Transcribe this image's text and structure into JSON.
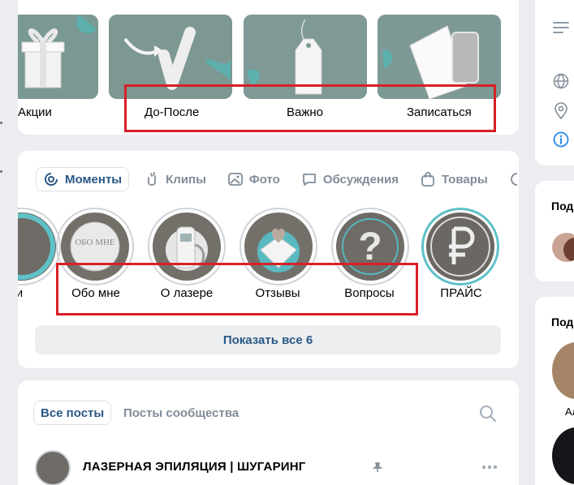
{
  "albums": {
    "items": [
      {
        "label": "Акции",
        "icon": "gift-icon"
      },
      {
        "label": "До-После",
        "icon": "checkmark-arrow-icon"
      },
      {
        "label": "Важно",
        "icon": "price-tag-icon"
      },
      {
        "label": "Записаться",
        "icon": "notepad-phone-icon"
      }
    ]
  },
  "moments": {
    "tabs": [
      {
        "label": "Моменты",
        "icon": "moments-icon",
        "active": true
      },
      {
        "label": "Клипы",
        "icon": "clips-icon"
      },
      {
        "label": "Фото",
        "icon": "photo-icon"
      },
      {
        "label": "Обсуждения",
        "icon": "discussions-icon"
      },
      {
        "label": "Товары",
        "icon": "products-icon"
      }
    ],
    "stories": [
      {
        "label": "и",
        "icon": "story-cropped"
      },
      {
        "label": "Обо мне",
        "inner_text": "ОБО МНЕ"
      },
      {
        "label": "О лазере",
        "icon": "laser-device-icon"
      },
      {
        "label": "Отзывы",
        "icon": "envelope-heart-icon"
      },
      {
        "label": "Вопросы",
        "icon": "question-mark-icon"
      },
      {
        "label": "ПРАЙС",
        "icon": "ruble-icon"
      }
    ],
    "show_all": "Показать все 6"
  },
  "posts": {
    "tab_all": "Все посты",
    "tab_community": "Посты сообщества",
    "post_title": "ЛАЗЕРНАЯ ЭПИЛЯЦИЯ | ШУГАРИНГ"
  },
  "right": {
    "label1": "Под",
    "label2": "Под",
    "label3": "Ал"
  },
  "colors": {
    "accent": "#2a5885",
    "highlight": "#d91f26",
    "teal": "#58b7bf"
  }
}
